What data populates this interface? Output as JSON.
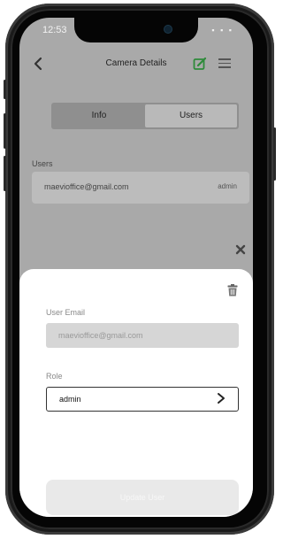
{
  "status_bar": {
    "time": "12:53",
    "indicators": "▪ ▪ ▪"
  },
  "header": {
    "title": "Camera Details",
    "back_icon": "chevron-left-icon",
    "edit_icon": "edit-icon",
    "menu_icon": "hamburger-menu-icon",
    "edit_color": "#2e8b3a"
  },
  "tabs": [
    {
      "label": "Info",
      "selected": false
    },
    {
      "label": "Users",
      "selected": true
    }
  ],
  "users_section": {
    "label": "Users",
    "users": [
      {
        "email": "maevioffice@gmail.com",
        "role": "admin"
      }
    ]
  },
  "modal": {
    "close_icon": "close-icon",
    "delete_icon": "trash-icon",
    "email_label": "User Email",
    "email_value": "maevioffice@gmail.com",
    "role_label": "Role",
    "role_value": "admin",
    "update_label": "Update User"
  }
}
